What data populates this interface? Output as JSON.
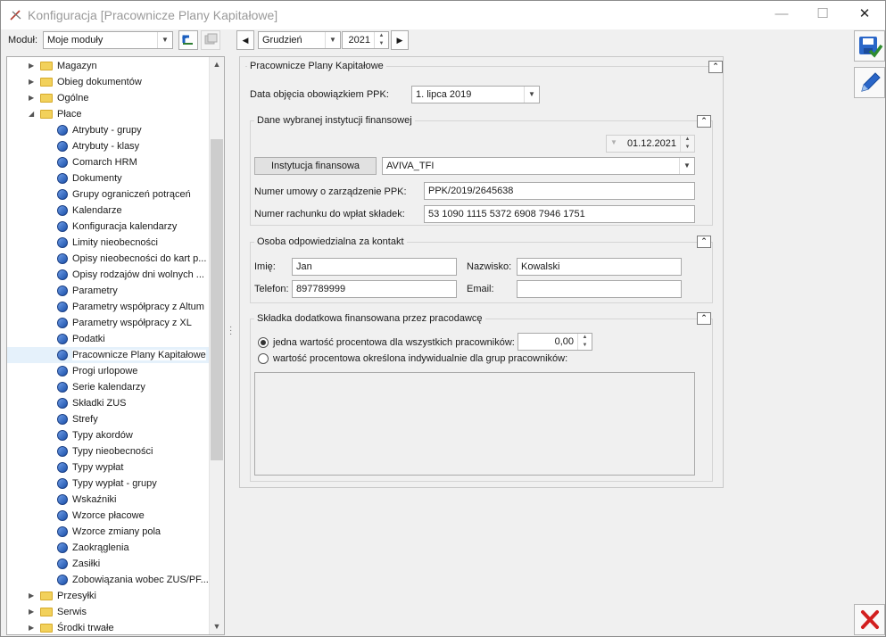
{
  "window": {
    "title": "Konfiguracja [Pracownicze Plany Kapitałowe]",
    "minimize_glyph": "—",
    "maximize_glyph": "☐",
    "close_glyph": "✕"
  },
  "toolbar": {
    "module_label": "Moduł:",
    "module_value": "Moje moduły",
    "month_value": "Grudzień",
    "year_value": "2021"
  },
  "tree": {
    "items": [
      {
        "label": "Magazyn",
        "type": "folder",
        "level": 0,
        "expander": "▶"
      },
      {
        "label": "Obieg dokumentów",
        "type": "folder",
        "level": 0,
        "expander": "▶"
      },
      {
        "label": "Ogólne",
        "type": "folder",
        "level": 0,
        "expander": "▶"
      },
      {
        "label": "Płace",
        "type": "folder",
        "level": 0,
        "expander": "◢"
      },
      {
        "label": "Atrybuty - grupy",
        "type": "leaf",
        "level": 1
      },
      {
        "label": "Atrybuty - klasy",
        "type": "leaf",
        "level": 1
      },
      {
        "label": "Comarch HRM",
        "type": "leaf",
        "level": 1
      },
      {
        "label": "Dokumenty",
        "type": "leaf",
        "level": 1
      },
      {
        "label": "Grupy ograniczeń potrąceń",
        "type": "leaf",
        "level": 1
      },
      {
        "label": "Kalendarze",
        "type": "leaf",
        "level": 1
      },
      {
        "label": "Konfiguracja kalendarzy",
        "type": "leaf",
        "level": 1
      },
      {
        "label": "Limity nieobecności",
        "type": "leaf",
        "level": 1
      },
      {
        "label": "Opisy nieobecności do kart p...",
        "type": "leaf",
        "level": 1
      },
      {
        "label": "Opisy rodzajów dni wolnych ...",
        "type": "leaf",
        "level": 1
      },
      {
        "label": "Parametry",
        "type": "leaf",
        "level": 1
      },
      {
        "label": "Parametry współpracy z Altum",
        "type": "leaf",
        "level": 1
      },
      {
        "label": "Parametry współpracy z XL",
        "type": "leaf",
        "level": 1
      },
      {
        "label": "Podatki",
        "type": "leaf",
        "level": 1
      },
      {
        "label": "Pracownicze Plany Kapitałowe",
        "type": "leaf",
        "level": 1,
        "selected": true
      },
      {
        "label": "Progi urlopowe",
        "type": "leaf",
        "level": 1
      },
      {
        "label": "Serie kalendarzy",
        "type": "leaf",
        "level": 1
      },
      {
        "label": "Składki ZUS",
        "type": "leaf",
        "level": 1
      },
      {
        "label": "Strefy",
        "type": "leaf",
        "level": 1
      },
      {
        "label": "Typy akordów",
        "type": "leaf",
        "level": 1
      },
      {
        "label": "Typy nieobecności",
        "type": "leaf",
        "level": 1
      },
      {
        "label": "Typy wypłat",
        "type": "leaf",
        "level": 1
      },
      {
        "label": "Typy wypłat - grupy",
        "type": "leaf",
        "level": 1
      },
      {
        "label": "Wskaźniki",
        "type": "leaf",
        "level": 1
      },
      {
        "label": "Wzorce płacowe",
        "type": "leaf",
        "level": 1
      },
      {
        "label": "Wzorce zmiany pola",
        "type": "leaf",
        "level": 1
      },
      {
        "label": "Zaokrąglenia",
        "type": "leaf",
        "level": 1
      },
      {
        "label": "Zasiłki",
        "type": "leaf",
        "level": 1
      },
      {
        "label": "Zobowiązania wobec ZUS/PF...",
        "type": "leaf",
        "level": 1
      },
      {
        "label": "Przesyłki",
        "type": "folder",
        "level": 0,
        "expander": "▶"
      },
      {
        "label": "Serwis",
        "type": "folder",
        "level": 0,
        "expander": "▶"
      },
      {
        "label": "Środki trwałe",
        "type": "folder",
        "level": 0,
        "expander": "▶"
      }
    ]
  },
  "ppk": {
    "group_title": "Pracownicze Plany Kapitałowe",
    "date_label": "Data objęcia obowiązkiem PPK:",
    "date_value": "1. lipca 2019",
    "institution": {
      "group_title": "Dane wybranej instytucji finansowej",
      "as_of_date": "01.12.2021",
      "institution_button": "Instytucja finansowa",
      "institution_value": "AVIVA_TFI",
      "contract_label": "Numer umowy o zarządzenie PPK:",
      "contract_value": "PPK/2019/2645638",
      "account_label": "Numer rachunku do wpłat składek:",
      "account_value": "53 1090 1115 5372 6908 7946 1751"
    },
    "contact": {
      "group_title": "Osoba odpowiedzialna za kontakt",
      "first_name_label": "Imię:",
      "first_name_value": "Jan",
      "last_name_label": "Nazwisko:",
      "last_name_value": "Kowalski",
      "phone_label": "Telefon:",
      "phone_value": "897789999",
      "email_label": "Email:",
      "email_value": ""
    },
    "contribution": {
      "group_title": "Składka dodatkowa finansowana przez pracodawcę",
      "option_single_label": "jedna wartość procentowa dla wszystkich pracowników:",
      "option_single_value": "0,00",
      "option_groups_label": "wartość procentowa określona indywidualnie dla grup pracowników:"
    }
  }
}
